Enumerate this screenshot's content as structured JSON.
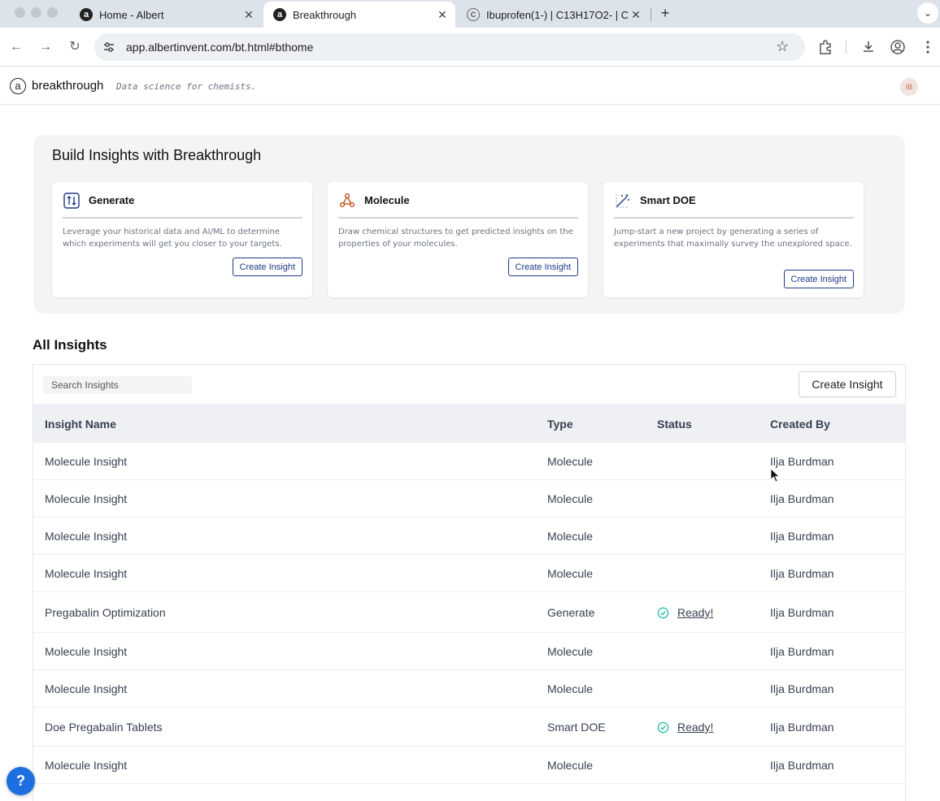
{
  "browser": {
    "tabs": [
      {
        "title": "Home - Albert",
        "favicon": "albert-a-icon"
      },
      {
        "title": "Breakthrough",
        "favicon": "albert-a-icon"
      },
      {
        "title": "Ibuprofen(1-) | C13H17O2- | C",
        "favicon": "copyright-c-icon"
      }
    ],
    "active_tab": 1,
    "url": "app.albertinvent.com/bt.html#bthome"
  },
  "app": {
    "logo_letter": "a",
    "brand": "breakthrough",
    "tagline": "Data science for chemists.",
    "user_initials": "IB"
  },
  "build": {
    "title": "Build Insights with Breakthrough",
    "cards": [
      {
        "title": "Generate",
        "icon": "generate-icon",
        "description": "Leverage your historical data and AI/ML to determine which experiments will get you closer to your targets.",
        "button": "Create Insight"
      },
      {
        "title": "Molecule",
        "icon": "molecule-icon",
        "description": "Draw chemical structures to get predicted insights on the properties of your molecules.",
        "button": "Create Insight"
      },
      {
        "title": "Smart DOE",
        "icon": "smart-doe-icon",
        "description": "Jump-start a new project by generating a series of experiments that maximally survey the unexplored space.",
        "button": "Create Insight"
      }
    ]
  },
  "insights": {
    "title": "All Insights",
    "search_placeholder": "Search Insights",
    "create_button": "Create Insight",
    "columns": [
      "Insight Name",
      "Type",
      "Status",
      "Created By"
    ],
    "rows": [
      {
        "name": "Molecule Insight",
        "type": "Molecule",
        "status": "",
        "created_by": "Ilja Burdman"
      },
      {
        "name": "Molecule Insight",
        "type": "Molecule",
        "status": "",
        "created_by": "Ilja Burdman"
      },
      {
        "name": "Molecule Insight",
        "type": "Molecule",
        "status": "",
        "created_by": "Ilja Burdman"
      },
      {
        "name": "Molecule Insight",
        "type": "Molecule",
        "status": "",
        "created_by": "Ilja Burdman"
      },
      {
        "name": "Pregabalin Optimization",
        "type": "Generate",
        "status": "Ready!",
        "created_by": "Ilja Burdman"
      },
      {
        "name": "Molecule Insight",
        "type": "Molecule",
        "status": "",
        "created_by": "Ilja Burdman"
      },
      {
        "name": "Molecule Insight",
        "type": "Molecule",
        "status": "",
        "created_by": "Ilja Burdman"
      },
      {
        "name": "Doe Pregabalin Tablets",
        "type": "Smart DOE",
        "status": "Ready!",
        "created_by": "Ilja Burdman"
      },
      {
        "name": "Molecule Insight",
        "type": "Molecule",
        "status": "",
        "created_by": "Ilja Burdman"
      }
    ]
  },
  "help_label": "?",
  "colors": {
    "accent": "#1e3a8a",
    "ready": "#14b8a6",
    "help": "#1d6fe0"
  }
}
